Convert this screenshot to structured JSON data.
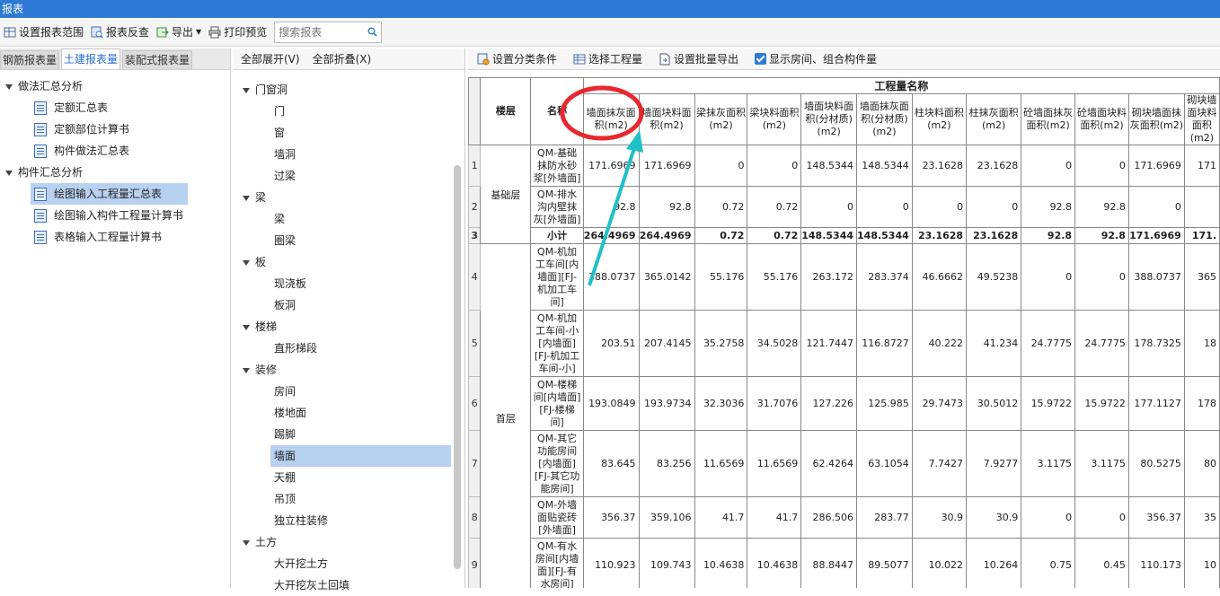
{
  "window": {
    "title": "报表"
  },
  "toolbar": {
    "set_range": "设置报表范围",
    "review": "报表反查",
    "export": "导出",
    "print_preview": "打印预览",
    "search_placeholder": "搜索报表"
  },
  "left_tabs": [
    "钢筋报表量",
    "土建报表量",
    "装配式报表量"
  ],
  "left_tree": {
    "group1": "做法汇总分析",
    "group1_items": [
      "定额汇总表",
      "定额部位计算书",
      "构件做法汇总表"
    ],
    "group2": "构件汇总分析",
    "group2_items": [
      "绘图输入工程量汇总表",
      "绘图输入构件工程量计算书",
      "表格输入工程量计算书"
    ]
  },
  "mid": {
    "expand_all": "全部展开(V)",
    "collapse_all": "全部折叠(X)",
    "tree": [
      {
        "label": "门窗洞",
        "level": 0
      },
      {
        "label": "门",
        "level": 1
      },
      {
        "label": "窗",
        "level": 1
      },
      {
        "label": "墙洞",
        "level": 1
      },
      {
        "label": "过梁",
        "level": 1
      },
      {
        "label": "梁",
        "level": 0
      },
      {
        "label": "梁",
        "level": 1
      },
      {
        "label": "圈梁",
        "level": 1
      },
      {
        "label": "板",
        "level": 0
      },
      {
        "label": "现浇板",
        "level": 1
      },
      {
        "label": "板洞",
        "level": 1
      },
      {
        "label": "楼梯",
        "level": 0
      },
      {
        "label": "直形梯段",
        "level": 1
      },
      {
        "label": "装修",
        "level": 0
      },
      {
        "label": "房间",
        "level": 1
      },
      {
        "label": "楼地面",
        "level": 1
      },
      {
        "label": "踢脚",
        "level": 1
      },
      {
        "label": "墙面",
        "level": 1,
        "selected": true
      },
      {
        "label": "天棚",
        "level": 1
      },
      {
        "label": "吊顶",
        "level": 1
      },
      {
        "label": "独立柱装修",
        "level": 1
      },
      {
        "label": "土方",
        "level": 0
      },
      {
        "label": "大开挖土方",
        "level": 1
      },
      {
        "label": "大开挖灰土回填",
        "level": 1
      }
    ]
  },
  "right_toolbar": {
    "category": "设置分类条件",
    "select_qty": "选择工程量",
    "batch_export": "设置批量导出",
    "show_rooms": "显示房间、组合构件量"
  },
  "table": {
    "floor_header": "楼层",
    "name_header": "名称",
    "group_header": "工程量名称",
    "columns": [
      "墙面抹灰面积(m2)",
      "墙面块料面积(m2)",
      "梁抹灰面积(m2)",
      "梁块料面积(m2)",
      "墙面块料面积(分材质)(m2)",
      "墙面抹灰面积(分材质)(m2)",
      "柱块料面积(m2)",
      "柱抹灰面积(m2)",
      "砼墙面抹灰面积(m2)",
      "砼墙面块料面积(m2)",
      "砌块墙面抹灰面积(m2)",
      "砌块墙面块料面积(m2)"
    ],
    "floors": [
      "基础层",
      "首层"
    ],
    "rows": [
      {
        "no": "1",
        "name": "QM-基础抹防水砂浆[外墙面]",
        "vals": [
          "171.6969",
          "171.6969",
          "0",
          "0",
          "148.5344",
          "148.5344",
          "23.1628",
          "23.1628",
          "0",
          "0",
          "171.6969",
          "171"
        ]
      },
      {
        "no": "2",
        "name": "QM-排水沟内壁抹灰[外墙面]",
        "vals": [
          "92.8",
          "92.8",
          "0.72",
          "0.72",
          "0",
          "0",
          "0",
          "0",
          "92.8",
          "92.8",
          "0",
          ""
        ]
      },
      {
        "no": "3",
        "name": "小计",
        "vals": [
          "264.4969",
          "264.4969",
          "0.72",
          "0.72",
          "148.5344",
          "148.5344",
          "23.1628",
          "23.1628",
          "92.8",
          "92.8",
          "171.6969",
          "171."
        ]
      },
      {
        "no": "4",
        "name": "QM-机加工车间[内墙面][FJ-机加工车间]",
        "vals": [
          "388.0737",
          "365.0142",
          "55.176",
          "55.176",
          "263.172",
          "283.374",
          "46.6662",
          "49.5238",
          "0",
          "0",
          "388.0737",
          "365"
        ]
      },
      {
        "no": "5",
        "name": "QM-机加工车间-小[内墙面][FJ-机加工车间-小]",
        "vals": [
          "203.51",
          "207.4145",
          "35.2758",
          "34.5028",
          "121.7447",
          "116.8727",
          "40.222",
          "41.234",
          "24.7775",
          "24.7775",
          "178.7325",
          "18"
        ]
      },
      {
        "no": "6",
        "name": "QM-楼梯间[内墙面][FJ-楼梯间]",
        "vals": [
          "193.0849",
          "193.9734",
          "32.3036",
          "31.7076",
          "127.226",
          "125.985",
          "29.7473",
          "30.5012",
          "15.9722",
          "15.9722",
          "177.1127",
          "178"
        ]
      },
      {
        "no": "7",
        "name": "QM-其它功能房间[内墙面][FJ-其它功能房间]",
        "vals": [
          "83.645",
          "83.256",
          "11.6569",
          "11.6569",
          "62.4264",
          "63.1054",
          "7.7427",
          "7.9277",
          "3.1175",
          "3.1175",
          "80.5275",
          "80"
        ]
      },
      {
        "no": "8",
        "name": "QM-外墙面贴瓷砖[外墙面]",
        "vals": [
          "356.37",
          "359.106",
          "41.7",
          "41.7",
          "286.506",
          "283.77",
          "30.9",
          "30.9",
          "0",
          "0",
          "356.37",
          "35"
        ]
      },
      {
        "no": "9",
        "name": "QM-有水房间[内墙面][FJ-有水房间]",
        "vals": [
          "110.923",
          "109.743",
          "10.4638",
          "10.4638",
          "88.8447",
          "89.5077",
          "10.022",
          "10.264",
          "0.75",
          "0.45",
          "110.173",
          "10"
        ]
      }
    ]
  },
  "annotation": {
    "color": "#e8282e",
    "arrow_color": "#1fc0c7"
  }
}
